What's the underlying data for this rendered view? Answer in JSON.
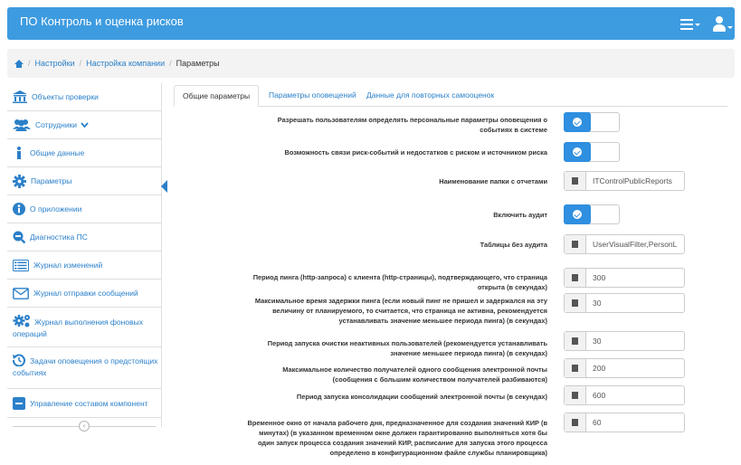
{
  "app": {
    "title": "ПО Контроль и оценка рисков"
  },
  "breadcrumb": {
    "items": [
      "Настройки",
      "Настройка компании",
      "Параметры"
    ],
    "separator": "/"
  },
  "sidebar": {
    "items": [
      {
        "label": "Объекты проверки",
        "icon": "bank-icon"
      },
      {
        "label": "Сотрудники",
        "icon": "users-icon"
      },
      {
        "label": "Общие данные",
        "icon": "info-icon"
      },
      {
        "label": "Параметры",
        "icon": "gear-icon",
        "active": true
      },
      {
        "label": "О приложении",
        "icon": "info-circle-icon"
      },
      {
        "label": "Диагностика ПС",
        "icon": "magnifier-icon"
      },
      {
        "label": "Журнал изменений",
        "icon": "list-icon"
      },
      {
        "label": "Журнал отправки сообщений",
        "icon": "envelope-icon"
      },
      {
        "label": "Журнал выполнения фоновых операций",
        "icon": "gears-icon"
      },
      {
        "label": "Задачи оповещения о предстоящих событиях",
        "icon": "history-icon"
      },
      {
        "label": "Управление составом компонент",
        "icon": "minus-square-icon"
      }
    ],
    "collapse_glyph": "‹"
  },
  "tabs": [
    {
      "label": "Общие параметры",
      "active": true
    },
    {
      "label": "Параметры оповещений",
      "active": false
    },
    {
      "label": "Данные для повторных самооценок",
      "active": false
    }
  ],
  "settings": [
    {
      "label": [
        "Разрешать пользователям определять персональные параметры оповещения о",
        "событиях в системе"
      ],
      "type": "toggle",
      "value": "on"
    },
    {
      "label": [
        "Возможность связи риск-событий и недостатков с риском и источником риска"
      ],
      "type": "toggle",
      "value": "on"
    },
    {
      "label": [
        "Наименование папки с отчетами"
      ],
      "type": "text",
      "value": "ITControlPublicReports"
    },
    {
      "label": [
        "Включить аудит"
      ],
      "type": "toggle",
      "value": "on"
    },
    {
      "label": [
        "Таблицы без аудита"
      ],
      "type": "text",
      "value": "UserVisualFilter,PersonL"
    },
    {
      "label": [
        "Период пинга (http-запроса) с клиента (http-страницы), подтверждающего, что страница",
        "открыта (в секундах)"
      ],
      "type": "number",
      "value": "300"
    },
    {
      "label": [
        "Максимальное время задержки пинга (если новый пинг не пришел и задержался на эту",
        "величину от планируемого, то считается, что страница не активна, рекомендуется",
        "устанавливать значение меньшее периода пинга) (в секундах)"
      ],
      "type": "number",
      "value": "30"
    },
    {
      "label": [
        "Период запуска очистки неактивных пользователей (рекомендуется устанавливать",
        "значение меньшее периода пинга) (в секундах)"
      ],
      "type": "number",
      "value": "30"
    },
    {
      "label": [
        "Максимальное количество получателей одного сообщения электронной почты",
        "(сообщения с большим количеством получателей разбиваются)"
      ],
      "type": "number",
      "value": "200"
    },
    {
      "label": [
        "Период запуска консолидации сообщений электронной почты (в секундах)"
      ],
      "type": "number",
      "value": "600"
    },
    {
      "label": [
        "Временное окно от начала рабочего дня, предназначенное для создания значений КИР (в",
        "минутах) (в указанном временном окне должен гарантированно выполняться хотя бы",
        "один запуск процесса создания значений КИР, расписание для запуска этого процесса",
        "определено в конфигурационном файле службы планировщика)"
      ],
      "type": "number",
      "value": "60"
    }
  ],
  "colors": {
    "brand": "#3d9be0",
    "link": "#2b80c9",
    "toggle_on": "#2f8fe0"
  }
}
